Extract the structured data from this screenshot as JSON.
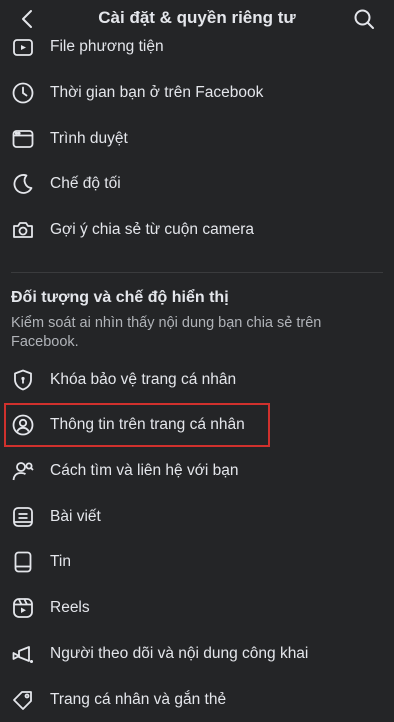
{
  "header": {
    "title": "Cài đặt & quyền riêng tư",
    "back_icon": "chevron-left-icon",
    "search_icon": "search-icon"
  },
  "top_items": [
    {
      "label": "File phương tiện",
      "icon": "media-file-icon"
    },
    {
      "label": "Thời gian bạn ở trên Facebook",
      "icon": "clock-icon"
    },
    {
      "label": "Trình duyệt",
      "icon": "browser-icon"
    },
    {
      "label": "Chế độ tối",
      "icon": "moon-icon"
    },
    {
      "label": "Gợi ý chia sẻ từ cuộn camera",
      "icon": "camera-icon"
    }
  ],
  "section": {
    "title": "Đối tượng và chế độ hiển thị",
    "description": "Kiểm soát ai nhìn thấy nội dung bạn chia sẻ trên Facebook."
  },
  "section_items": [
    {
      "label": "Khóa bảo vệ trang cá nhân",
      "icon": "shield-lock-icon"
    },
    {
      "label": "Thông tin trên trang cá nhân",
      "icon": "profile-circle-icon",
      "highlighted": true
    },
    {
      "label": "Cách tìm và liên hệ với bạn",
      "icon": "find-people-icon"
    },
    {
      "label": "Bài viết",
      "icon": "posts-icon"
    },
    {
      "label": "Tin",
      "icon": "stories-icon"
    },
    {
      "label": "Reels",
      "icon": "reels-icon"
    },
    {
      "label": "Người theo dõi và nội dung công khai",
      "icon": "followers-icon"
    },
    {
      "label": "Trang cá nhân và gắn thẻ",
      "icon": "tag-icon"
    }
  ],
  "colors": {
    "background": "#242527",
    "text": "#e4e6eb",
    "secondary_text": "#b0b3b8",
    "highlight_border": "#d0312d"
  }
}
